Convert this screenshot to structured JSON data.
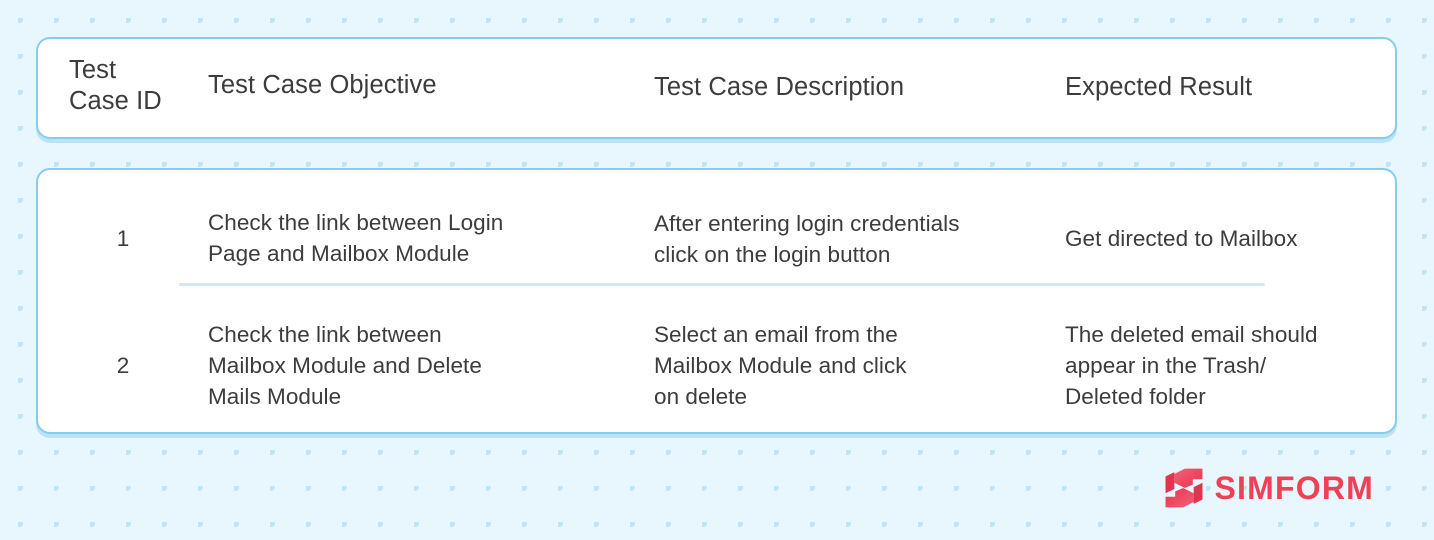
{
  "theme": {
    "background": "#e8f6fd",
    "dot_color": "#bde4f7",
    "card_border": "#86cdeb",
    "card_fill": "#ffffff",
    "text_color": "#3c3c3c",
    "divider_color": "#cfe9f6",
    "brand_color": "#ef4056"
  },
  "table": {
    "columns": [
      {
        "key": "id",
        "label_lines": [
          "Test",
          "Case ID"
        ]
      },
      {
        "key": "obj",
        "label_lines": [
          "Test Case Objective"
        ]
      },
      {
        "key": "desc",
        "label_lines": [
          "Test Case Description"
        ]
      },
      {
        "key": "exp",
        "label_lines": [
          "Expected Result"
        ]
      }
    ],
    "rows": [
      {
        "id": "1",
        "objective_lines": [
          "Check the link between Login",
          "Page and Mailbox Module"
        ],
        "description_lines": [
          "After entering login credentials",
          "click on the login button"
        ],
        "expected_lines": [
          "Get directed to Mailbox"
        ]
      },
      {
        "id": "2",
        "objective_lines": [
          "Check the link between",
          "Mailbox Module and Delete",
          "Mails Module"
        ],
        "description_lines": [
          "Select an email from the",
          "Mailbox Module and click",
          "on delete"
        ],
        "expected_lines": [
          "The deleted email should",
          "appear in the Trash/",
          "Deleted folder"
        ]
      }
    ]
  },
  "branding": {
    "wordmark": "SIMFORM",
    "mark_name": "simform-logo-mark"
  }
}
